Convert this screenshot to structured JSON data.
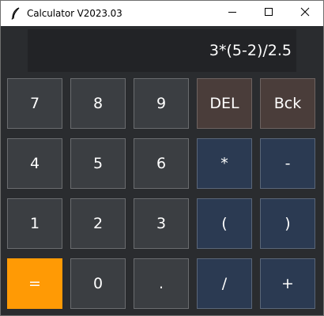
{
  "window": {
    "title": "Calculator V2023.03"
  },
  "title_controls": {
    "minimize_icon": "minimize-icon",
    "maximize_icon": "maximize-icon",
    "close_icon": "close-icon"
  },
  "display": {
    "expression": "3*(5-2)/2.5"
  },
  "buttons": {
    "k7": "7",
    "k8": "8",
    "k9": "9",
    "del": "DEL",
    "bck": "Bck",
    "k4": "4",
    "k5": "5",
    "k6": "6",
    "mul": "*",
    "sub": "-",
    "k1": "1",
    "k2": "2",
    "k3": "3",
    "lparen": "(",
    "rparen": ")",
    "eq": "=",
    "k0": "0",
    "dot": ".",
    "div": "/",
    "add": "+"
  },
  "colors": {
    "background": "#2a2c2f",
    "number_key": "#3b3e42",
    "operator_key": "#2b3a52",
    "delete_key": "#4a3d3a",
    "equals_key": "#ff9a05",
    "display": "#222326",
    "text": "#ffffff"
  }
}
